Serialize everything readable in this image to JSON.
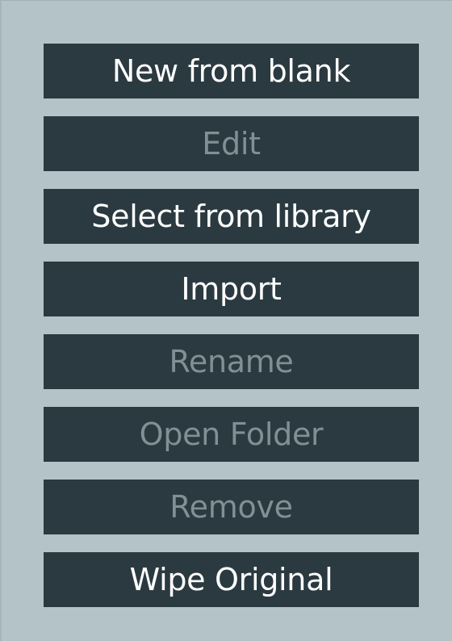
{
  "menu": {
    "buttons": [
      {
        "label": "New from blank",
        "enabled": true
      },
      {
        "label": "Edit",
        "enabled": false
      },
      {
        "label": "Select from library",
        "enabled": true
      },
      {
        "label": "Import",
        "enabled": true
      },
      {
        "label": "Rename",
        "enabled": false
      },
      {
        "label": "Open Folder",
        "enabled": false
      },
      {
        "label": "Remove",
        "enabled": false
      },
      {
        "label": "Wipe Original",
        "enabled": true
      }
    ]
  },
  "colors": {
    "panel_background": "#b4c3c8",
    "button_background": "#2b3a40",
    "enabled_text": "#ffffff",
    "disabled_text": "#828f94"
  }
}
